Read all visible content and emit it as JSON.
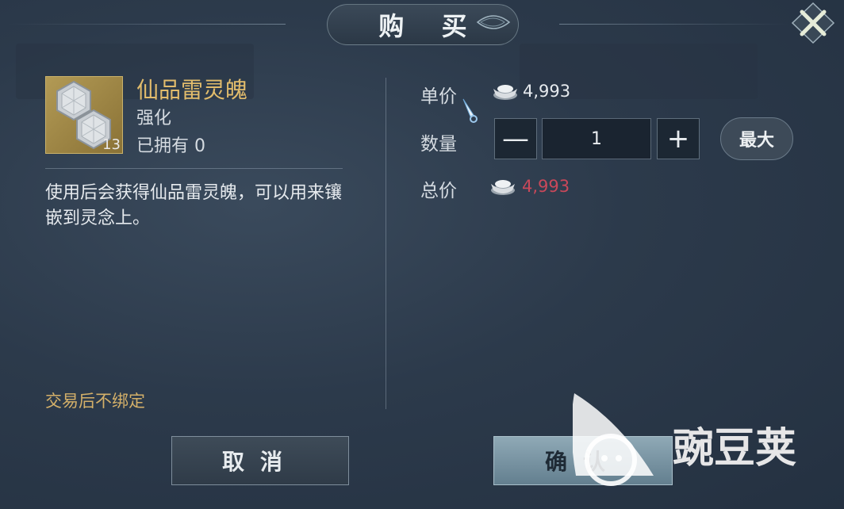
{
  "dialog": {
    "title": "购 买"
  },
  "item": {
    "name": "仙品雷灵魄",
    "type": "强化",
    "owned_text": "已拥有 0",
    "icon_count": "13",
    "description": "使用后会获得仙品雷灵魄，可以用来镶嵌到灵念上。",
    "bind_note": "交易后不绑定"
  },
  "purchase": {
    "unit_price_label": "单价",
    "unit_price": "4,993",
    "quantity_label": "数量",
    "quantity": "1",
    "minus_label": "—",
    "plus_label": "+",
    "max_label": "最大",
    "total_label": "总价",
    "total_price": "4,993"
  },
  "buttons": {
    "cancel": "取消",
    "confirm": "确认"
  },
  "watermark": {
    "text": "豌豆荚"
  },
  "colors": {
    "item_name": "#e2bc6c",
    "total_price": "#c9485a",
    "bind_note": "#d4b069"
  },
  "icons": [
    "close-icon",
    "silver-ingot-icon",
    "hexagon-gem-icon",
    "sword-cursor-icon",
    "wandoujia-logo-icon"
  ]
}
